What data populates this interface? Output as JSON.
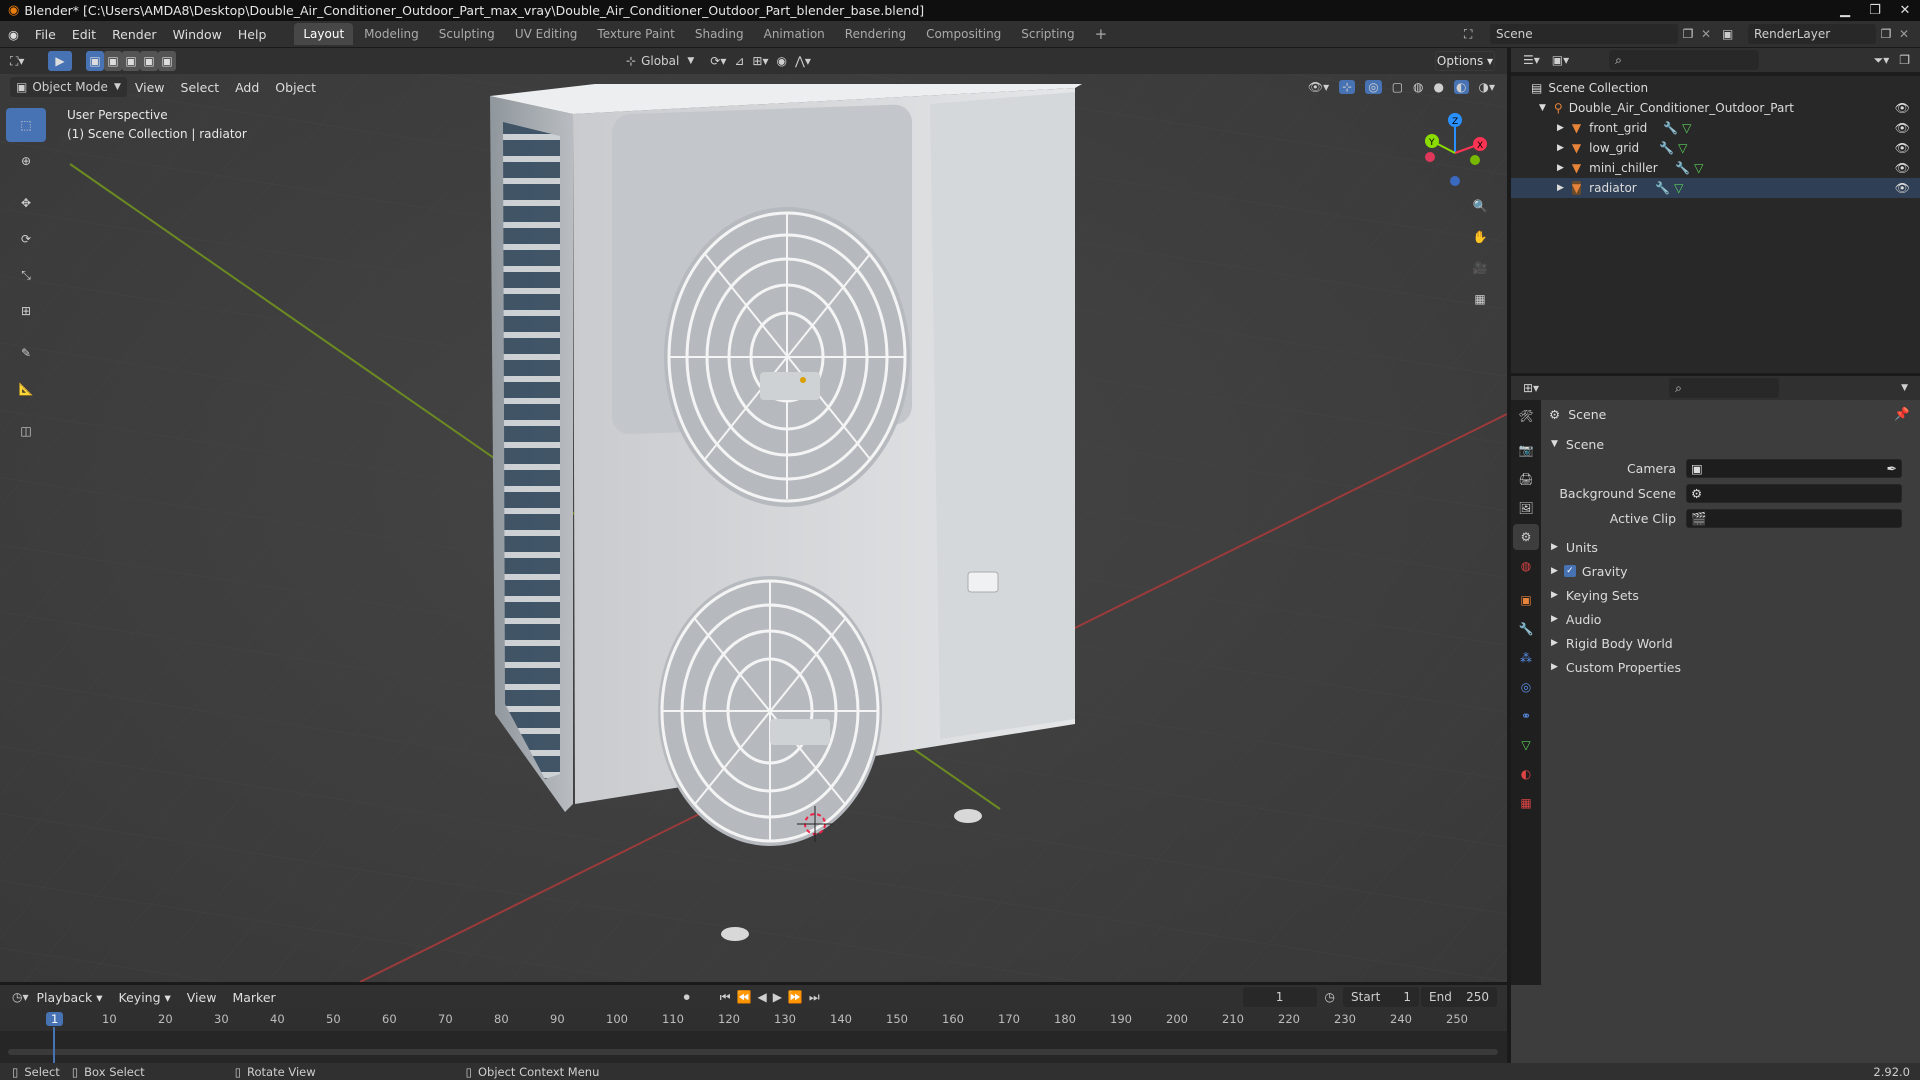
{
  "window": {
    "title": "Blender* [C:\\Users\\AMDA8\\Desktop\\Double_Air_Conditioner_Outdoor_Part_max_vray\\Double_Air_Conditioner_Outdoor_Part_blender_base.blend]",
    "version": "2.92.0"
  },
  "menu": {
    "items": [
      "File",
      "Edit",
      "Render",
      "Window",
      "Help"
    ],
    "workspaces": [
      "Layout",
      "Modeling",
      "Sculpting",
      "UV Editing",
      "Texture Paint",
      "Shading",
      "Animation",
      "Rendering",
      "Compositing",
      "Scripting"
    ],
    "active_workspace": "Layout",
    "scene": "Scene",
    "render_layer": "RenderLayer"
  },
  "viewport": {
    "mode": "Object Mode",
    "menus": [
      "View",
      "Select",
      "Add",
      "Object"
    ],
    "orientation": "Global",
    "options": "Options",
    "perspective": "User Perspective",
    "collection_info": "(1) Scene Collection | radiator",
    "gizmo_labels": {
      "x": "X",
      "y": "Y",
      "z": "Z"
    }
  },
  "outliner": {
    "root": "Scene Collection",
    "collection": "Double_Air_Conditioner_Outdoor_Part",
    "objects": [
      "front_grid",
      "low_grid",
      "mini_chiller",
      "radiator"
    ]
  },
  "properties": {
    "header": "Scene",
    "panel_title": "Scene",
    "fields": [
      {
        "label": "Camera",
        "value": ""
      },
      {
        "label": "Background Scene",
        "value": ""
      },
      {
        "label": "Active Clip",
        "value": ""
      }
    ],
    "sections": [
      "Units",
      "Gravity",
      "Keying Sets",
      "Audio",
      "Rigid Body World",
      "Custom Properties"
    ],
    "gravity_checked": true
  },
  "timeline": {
    "menus": [
      "Playback",
      "Keying",
      "View",
      "Marker"
    ],
    "current_frame": "1",
    "start_label": "Start",
    "start": "1",
    "end_label": "End",
    "end": "250",
    "ticks": [
      "1",
      "10",
      "20",
      "30",
      "40",
      "50",
      "60",
      "70",
      "80",
      "90",
      "100",
      "110",
      "120",
      "130",
      "140",
      "150",
      "160",
      "170",
      "180",
      "190",
      "200",
      "210",
      "220",
      "230",
      "240",
      "250"
    ]
  },
  "status": {
    "select": "Select",
    "box_select": "Box Select",
    "rotate": "Rotate View",
    "context": "Object Context Menu"
  },
  "colors": {
    "accent": "#4772b3",
    "axis_x": "#ff3352",
    "axis_y": "#8bdc00",
    "axis_z": "#2890ff",
    "active_frame": "#4772b3",
    "orange_object": "#e8833a"
  }
}
